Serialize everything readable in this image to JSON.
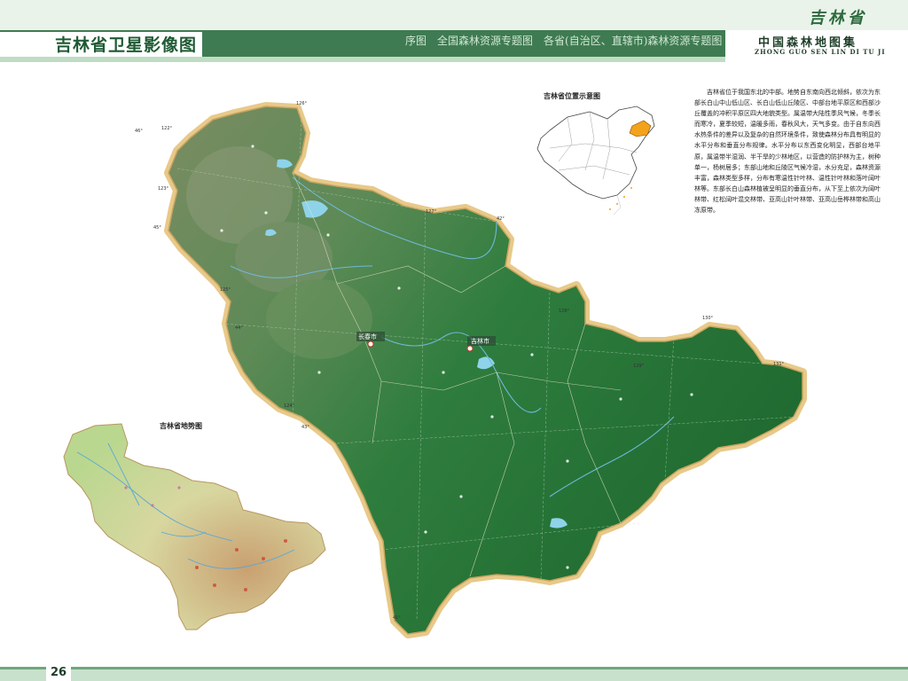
{
  "header": {
    "page_title": "吉林省卫星影像图",
    "breadcrumb": [
      "序图",
      "全国森林资源专题图",
      "各省(自治区、直辖市)森林资源专题图"
    ],
    "province_name": "吉林省",
    "atlas_title": "中国森林地图集",
    "atlas_pinyin": "ZHONG GUO SEN LIN DI TU JI"
  },
  "location_inset": {
    "title": "吉林省位置示意图",
    "highlight_color": "#f3a21b"
  },
  "terrain_inset": {
    "title": "吉林省地势图"
  },
  "description": "吉林省位于我国东北的中部。地势自东南向西北倾斜，依次为东部长白山中山低山区、长白山低山丘陵区、中部台地平原区和西部沙丘覆盖的冲积平原区四大地貌类型。属温带大陆性季风气候，冬季长而寒冷，夏季较短，温暖多雨，春秋风大，天气多变。由于自东向西水热条件的差异以及复杂的自然环境条件，致使森林分布具有明显的水平分布和垂直分布规律。水平分布以东西变化明显，西部台地平原，属温带半湿润、半干旱的少林地区，以营造的防护林为主，树种单一，杨树居多；东部山地和丘陵区气候冷湿，水分充足，森林资源丰富，森林类型多样，分布有寒温性针叶林、温性针叶林和落叶阔叶林等。东部长白山森林植被呈明显的垂直分布，从下至上依次为阔叶林带、红松阔叶混交林带、亚高山针叶林带、亚高山岳桦林带和高山冻原带。",
  "map_labels": {
    "changchun": "长春市",
    "jilin": "吉林市"
  },
  "coord_labels": [
    "126°",
    "127°",
    "128°",
    "129°",
    "130°",
    "131°",
    "125°",
    "124°",
    "123°",
    "122°",
    "46°",
    "45°",
    "44°",
    "43°",
    "42°",
    "41°"
  ],
  "colors": {
    "header_dark": "#3f7b52",
    "header_light": "#e9f3e9",
    "forest": "#2f7a3a",
    "plain": "#5f8c55",
    "border_halo": "#e8c98a"
  },
  "footer": {
    "page_number": "26"
  }
}
